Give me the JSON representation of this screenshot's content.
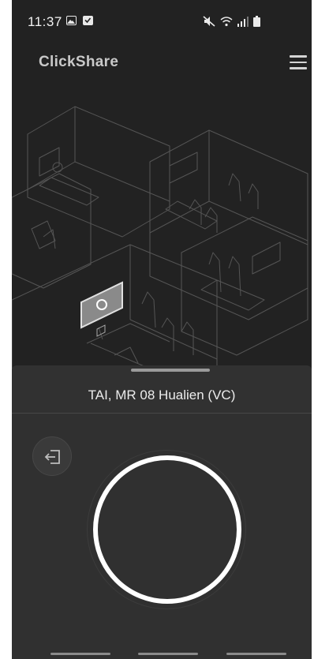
{
  "status_bar": {
    "time": "11:37",
    "left_icons": [
      "image-icon",
      "checkbox-icon"
    ],
    "right_icons": [
      "mute-icon",
      "wifi-icon",
      "signal-icon",
      "battery-icon"
    ]
  },
  "header": {
    "brand": "ClickShare",
    "menu_icon": "hamburger-menu-icon"
  },
  "illustration": {
    "subject": "office-floorplan",
    "highlight_color": "#d9d9d9"
  },
  "sheet": {
    "room_name": "TAI, MR 08 Hualien (VC)",
    "exit_icon": "exit-icon",
    "share_button_icon": "share-circle-icon"
  },
  "colors": {
    "background": "#222222",
    "sheet": "#313131",
    "ring": "#ffffff"
  }
}
